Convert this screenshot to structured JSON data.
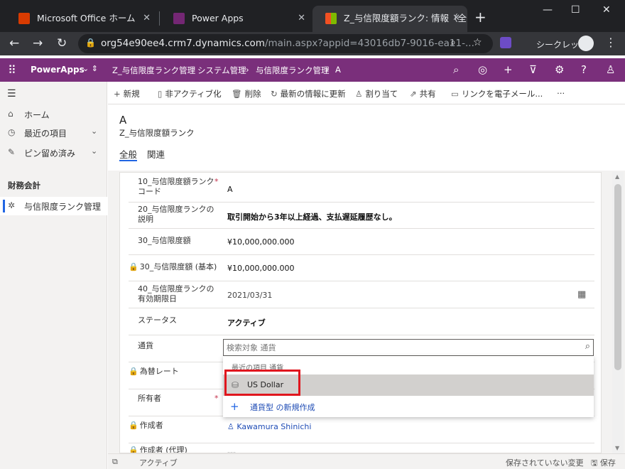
{
  "browser": {
    "tabs": [
      {
        "title": "Microsoft Office ホーム",
        "icon": "office-icon",
        "color": "#d83b01"
      },
      {
        "title": "Power Apps",
        "icon": "powerapps-icon",
        "color": "#742774"
      },
      {
        "title": "Z_与信限度額ランク: 情報（全",
        "icon": "dynamics-icon",
        "color": "#0078d4"
      }
    ],
    "url_host": "org54e90ee4.crm7.dynamics.com",
    "url_path": "/main.aspx?appid=43016db7-9016-ea11-...",
    "incognito_label": "シークレット"
  },
  "header": {
    "brand": "PowerApps",
    "app_name": "Z_与信限度ランク管理",
    "breadcrumb": [
      "システム管理",
      "与信限度ランク管理",
      "A"
    ]
  },
  "sidebar": {
    "items": [
      {
        "label": "ホーム",
        "icon": "home-icon"
      },
      {
        "label": "最近の項目",
        "icon": "clock-icon"
      },
      {
        "label": "ピン留め済み",
        "icon": "pin-icon"
      }
    ],
    "group_label": "財務会計",
    "group_items": [
      {
        "label": "与信限度ランク管理",
        "icon": "puzzle-icon"
      }
    ]
  },
  "commandbar": {
    "new": "新規",
    "deactivate": "非アクティブ化",
    "delete": "削除",
    "refresh": "最新の情報に更新",
    "assign": "割り当て",
    "share": "共有",
    "email_link": "リンクを電子メール...",
    "more": "⋯"
  },
  "record": {
    "title": "A",
    "entity": "Z_与信限度額ランク",
    "tabs": [
      "全般",
      "関連"
    ]
  },
  "form": {
    "fields": [
      {
        "label": "10_与信限度額ランクコード",
        "value": "A"
      },
      {
        "label": "20_与信限度ランクの説明",
        "value": "取引開始から3年以上経過、支払遅延履歴なし。"
      },
      {
        "label": "30_与信限度額",
        "value": "¥10,000,000.000"
      },
      {
        "label": "30_与信限度額 (基本)",
        "value": "¥10,000,000.000"
      },
      {
        "label": "40_与信限度ランクの有効期限日",
        "value": "2021/03/31"
      },
      {
        "label": "ステータス",
        "value": "アクティブ"
      },
      {
        "label": "通貨",
        "value": ""
      },
      {
        "label": "為替レート",
        "value": ""
      },
      {
        "label": "所有者",
        "value": ""
      },
      {
        "label": "作成者",
        "value": "Kawamura Shinichi"
      },
      {
        "label": "作成者 (代理)",
        "value": "---"
      }
    ],
    "currency_placeholder": "検索対象 通貨",
    "dropdown": {
      "header": "最近の項目 通貨",
      "item": "US Dollar",
      "new_label": "通貨型 の新規作成"
    }
  },
  "statusbar": {
    "status": "アクティブ",
    "unsaved": "保存されていない変更",
    "save": "保存"
  }
}
